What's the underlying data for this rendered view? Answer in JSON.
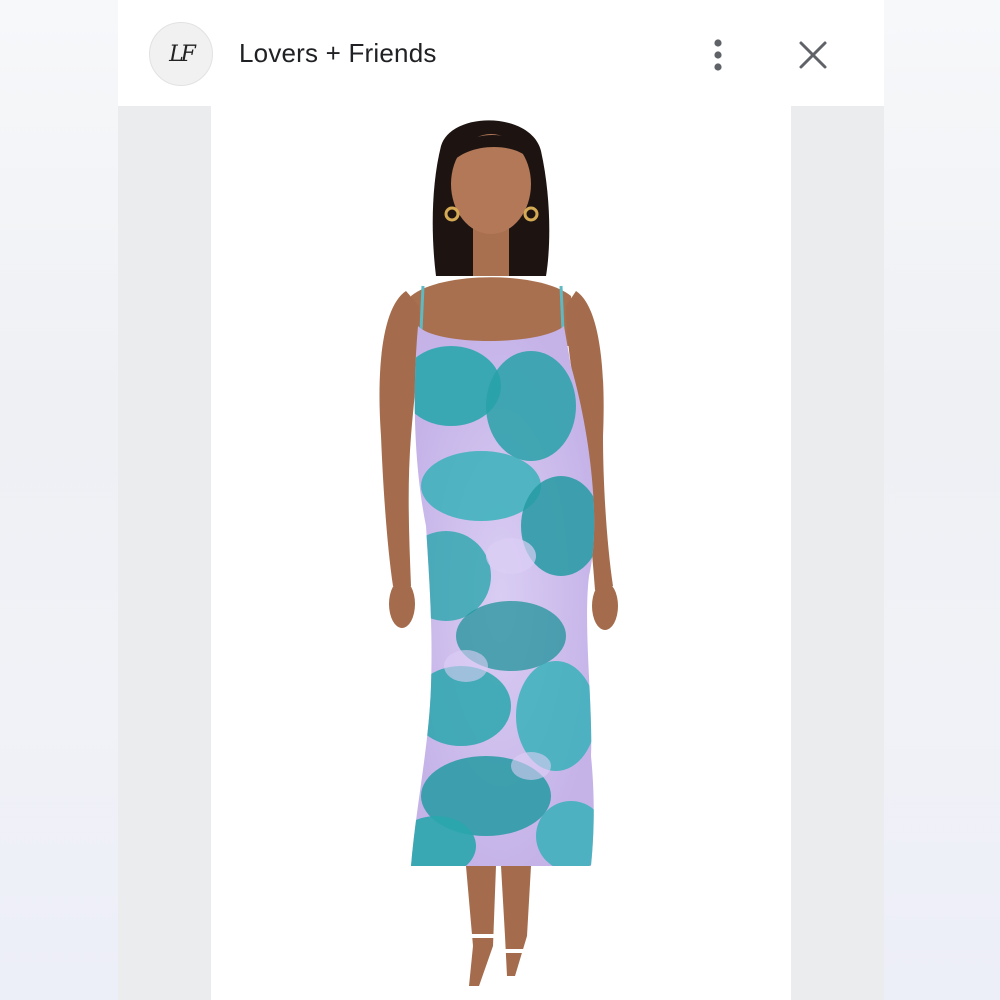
{
  "header": {
    "brand_name": "Lovers + Friends",
    "avatar_monogram": "LF"
  },
  "icons": {
    "menu": "more-vertical-icon",
    "close": "close-icon"
  },
  "image": {
    "description_alt": "product photo",
    "colors": {
      "teal": "#2aa6ad",
      "lavender": "#c9b7ea",
      "skin": "#a8704f",
      "hair": "#1d1412"
    }
  }
}
